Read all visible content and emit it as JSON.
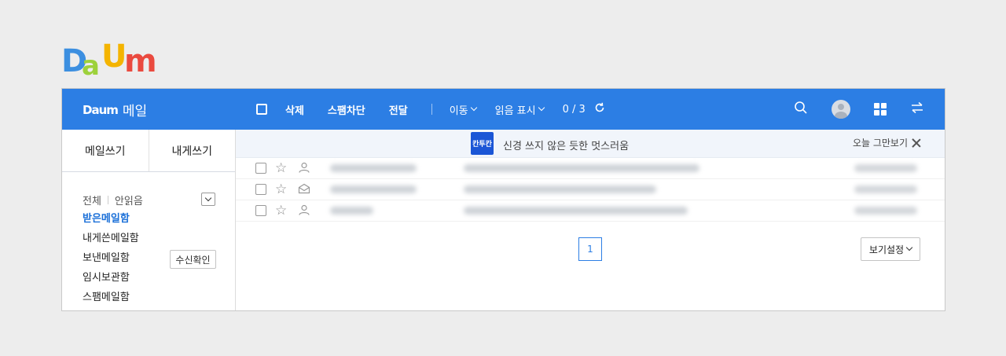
{
  "brand": {
    "logo_letters": [
      "D",
      "a",
      "U",
      "m"
    ],
    "logo_colors": [
      "#3c8fe0",
      "#9dd13b",
      "#f4b400",
      "#ea4a3f"
    ]
  },
  "topbar": {
    "logo": "Daum",
    "title": "메일",
    "actions": {
      "delete": "삭제",
      "spam_block": "스팸차단",
      "forward": "전달",
      "move": "이동",
      "mark_read": "읽음 표시"
    },
    "count": "0 / 3",
    "icons": [
      "search-icon",
      "avatar",
      "apps-grid-icon",
      "switch-arrows-icon"
    ],
    "color": "#2c7ee4"
  },
  "sidebar": {
    "compose": "메일쓰기",
    "compose_self": "내게쓰기",
    "filter_all": "전체",
    "filter_unread": "안읽음",
    "folders": [
      "받은메일함",
      "내게쓴메일함",
      "보낸메일함",
      "임시보관함",
      "스팸메일함"
    ],
    "receipt_check": "수신확인"
  },
  "banner": {
    "badge": "칸투칸",
    "text": "신경 쓰지 않은 듯한 멋스러움",
    "close": "오늘 그만보기"
  },
  "pagination": {
    "current": "1"
  },
  "view_setting": "보기설정"
}
